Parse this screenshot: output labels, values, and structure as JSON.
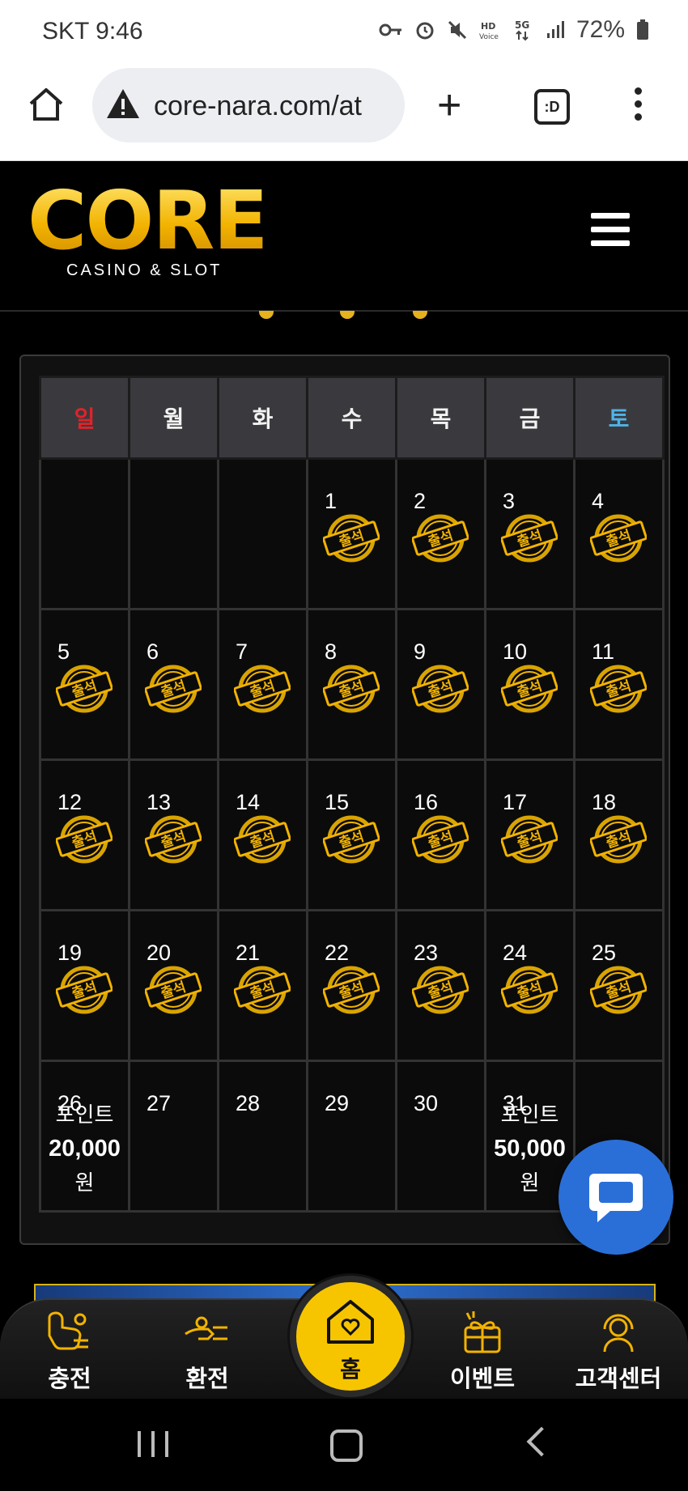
{
  "status_bar": {
    "carrier_time": "SKT 9:46",
    "battery": "72%",
    "icons": [
      "key-icon",
      "alarm-icon",
      "mute-icon",
      "hd-voice-icon",
      "5g-icon",
      "signal-icon",
      "battery-icon"
    ]
  },
  "browser": {
    "url": "core-nara.com/at",
    "tabs_label": ":D"
  },
  "site": {
    "logo_text": "CORE",
    "logo_sub": "CASINO & SLOT"
  },
  "calendar": {
    "weekdays": [
      "일",
      "월",
      "화",
      "수",
      "목",
      "금",
      "토"
    ],
    "weeks": [
      [
        "",
        "",
        "",
        "1",
        "2",
        "3",
        "4"
      ],
      [
        "5",
        "6",
        "7",
        "8",
        "9",
        "10",
        "11"
      ],
      [
        "12",
        "13",
        "14",
        "15",
        "16",
        "17",
        "18"
      ],
      [
        "19",
        "20",
        "21",
        "22",
        "23",
        "24",
        "25"
      ],
      [
        "26",
        "27",
        "28",
        "29",
        "30",
        "31",
        ""
      ]
    ],
    "stamp_label": "출석",
    "reward_1": {
      "line1": "포인트",
      "amount": "20,000",
      "unit": "원"
    },
    "reward_2": {
      "line1": "포인트",
      "amount": "50,000",
      "unit": "원"
    }
  },
  "bottom_nav": {
    "charge": "충전",
    "exchange": "환전",
    "home": "홈",
    "event": "이벤트",
    "support": "고객센터"
  },
  "colors": {
    "gold": "#f2b300",
    "sunday": "#e0232b",
    "saturday": "#4fb3e8",
    "chat_blue": "#2a6fd8"
  }
}
